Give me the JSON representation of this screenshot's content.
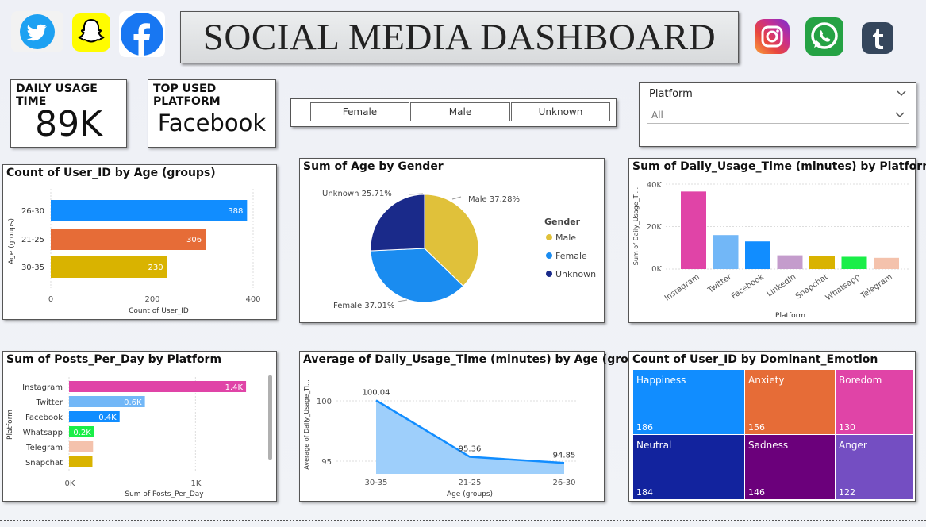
{
  "header": {
    "title": "SOCIAL MEDIA DASHBOARD",
    "icons_left": [
      "twitter-icon",
      "snapchat-icon",
      "facebook-icon"
    ],
    "icons_right": [
      "instagram-icon",
      "whatsapp-icon",
      "tumblr-icon"
    ]
  },
  "kpi": {
    "usage_label": "DAILY USAGE TIME",
    "usage_value": "89K",
    "platform_label": "TOP USED PLATFORM",
    "platform_value": "Facebook"
  },
  "gender_slicer": {
    "options": [
      "Female",
      "Male",
      "Unknown"
    ]
  },
  "platform_filter": {
    "label": "Platform",
    "value": "All"
  },
  "colors": {
    "blue": "#118dff",
    "orange": "#e66c37",
    "yellow": "#d9b300",
    "pie_yellow": "#e0c13a",
    "pie_blue": "#1a8cf0",
    "pie_navy": "#1a2a8a",
    "instagram": "#e044a7",
    "twitter": "#72b7f7",
    "facebook": "#118dff",
    "linkedin": "#c49ccc",
    "snapchat": "#d9b300",
    "whatsapp": "#1aee48",
    "telegram": "#f4c2ac"
  },
  "charts": {
    "age": {
      "title": "Count of User_ID by Age (groups)",
      "ylabel": "Age (groups)",
      "xlabel": "Count of User_ID",
      "xticks": [
        "0",
        "200",
        "400"
      ]
    },
    "gender": {
      "title": "Sum of Age by Gender",
      "legend_title": "Gender",
      "labels": [
        "Male 37.28%",
        "Female 37.01%",
        "Unknown 25.71%"
      ]
    },
    "usage_platform": {
      "title": "Sum of Daily_Usage_Time (minutes) by Platform",
      "ylabel": "Sum of Daily_Usage_Ti...",
      "xlabel": "Platform",
      "yticks": [
        "40K",
        "20K",
        "0K"
      ]
    },
    "posts": {
      "title": "Sum of Posts_Per_Day by Platform",
      "ylabel": "Platform",
      "xlabel": "Sum of Posts_Per_Day",
      "xticks": [
        "0K",
        "1K"
      ]
    },
    "avg_usage": {
      "title": "Average of Daily_Usage_Time (minutes) by Age (groups)",
      "ylabel": "Average of Daily_Usage_Ti...",
      "xlabel": "Age (groups)",
      "yticks": [
        "100",
        "95"
      ]
    },
    "emotion": {
      "title": "Count of User_ID by Dominant_Emotion"
    }
  },
  "chart_data": [
    {
      "type": "bar",
      "orientation": "horizontal",
      "title": "Count of User_ID by Age (groups)",
      "categories": [
        "26-30",
        "21-25",
        "30-35"
      ],
      "values": [
        388,
        306,
        230
      ],
      "colors": [
        "#118dff",
        "#e66c37",
        "#d9b300"
      ],
      "xlim": [
        0,
        400
      ]
    },
    {
      "type": "pie",
      "title": "Sum of Age by Gender",
      "categories": [
        "Male",
        "Female",
        "Unknown"
      ],
      "values": [
        37.28,
        37.01,
        25.71
      ],
      "colors": [
        "#e0c13a",
        "#1a8cf0",
        "#1a2a8a"
      ],
      "legend": "right"
    },
    {
      "type": "bar",
      "title": "Sum of Daily_Usage_Time (minutes) by Platform",
      "categories": [
        "Instagram",
        "Twitter",
        "Facebook",
        "LinkedIn",
        "Snapchat",
        "Whatsapp",
        "Telegram"
      ],
      "values": [
        36500,
        16000,
        13000,
        6500,
        6000,
        5800,
        5300
      ],
      "colors": [
        "#e044a7",
        "#72b7f7",
        "#118dff",
        "#c49ccc",
        "#d9b300",
        "#1aee48",
        "#f4c2ac"
      ],
      "ylim": [
        0,
        40000
      ]
    },
    {
      "type": "bar",
      "orientation": "horizontal",
      "title": "Sum of Posts_Per_Day by Platform",
      "categories": [
        "Instagram",
        "Twitter",
        "Facebook",
        "Whatsapp",
        "Telegram",
        "Snapchat"
      ],
      "values": [
        1400,
        600,
        400,
        200,
        190,
        185
      ],
      "labels": [
        "1.4K",
        "0.6K",
        "0.4K",
        "0.2K",
        "",
        ""
      ],
      "colors": [
        "#e044a7",
        "#72b7f7",
        "#118dff",
        "#1aee48",
        "#f4c2ac",
        "#d9b300"
      ],
      "xlim": [
        0,
        1500
      ]
    },
    {
      "type": "area",
      "title": "Average of Daily_Usage_Time (minutes) by Age (groups)",
      "x": [
        "30-35",
        "21-25",
        "26-30"
      ],
      "values": [
        100.04,
        95.36,
        94.85
      ],
      "ylim": [
        94,
        101
      ]
    },
    {
      "type": "treemap",
      "title": "Count of User_ID by Dominant_Emotion",
      "categories": [
        "Happiness",
        "Neutral",
        "Anxiety",
        "Sadness",
        "Boredom",
        "Anger"
      ],
      "values": [
        186,
        184,
        156,
        146,
        130,
        122
      ],
      "colors": [
        "#118dff",
        "#12239e",
        "#e66c37",
        "#6b007b",
        "#e044a7",
        "#744ec2"
      ]
    }
  ]
}
